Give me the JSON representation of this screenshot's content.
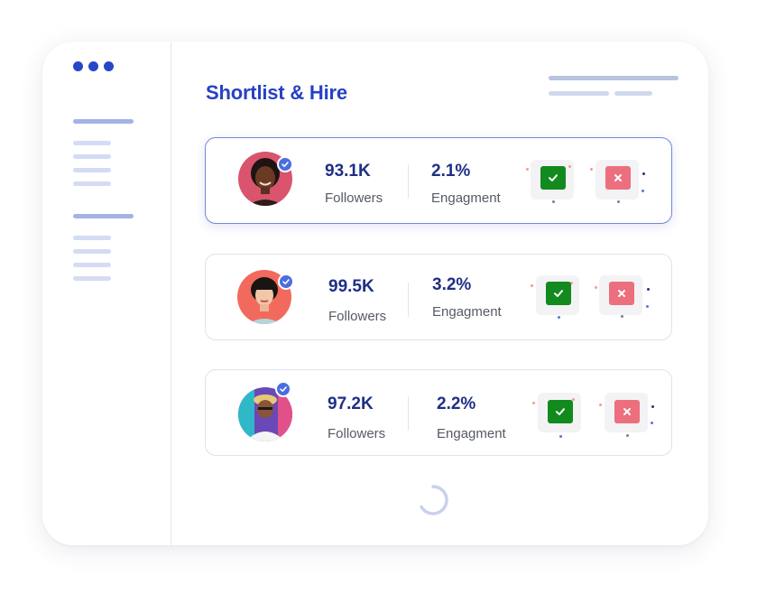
{
  "header": {
    "title": "Shortlist & Hire"
  },
  "cards": [
    {
      "followers_value": "93.1K",
      "followers_label": "Followers",
      "engagement_value": "2.1%",
      "engagement_label": "Engagment",
      "selected": true
    },
    {
      "followers_value": "99.5K",
      "followers_label": "Followers",
      "engagement_value": "3.2%",
      "engagement_label": "Engagment",
      "selected": false
    },
    {
      "followers_value": "97.2K",
      "followers_label": "Followers",
      "engagement_value": "2.2%",
      "engagement_label": "Engagment",
      "selected": false
    }
  ],
  "colors": {
    "accent": "#2741c5",
    "approve": "#128a1e",
    "reject": "#ec6f7d",
    "verified": "#4a6ee0"
  },
  "icons": {
    "window_dots": "dots-icon",
    "verified": "verified-check-icon",
    "approve": "check-icon",
    "reject": "close-icon",
    "loading": "spinner-icon"
  }
}
